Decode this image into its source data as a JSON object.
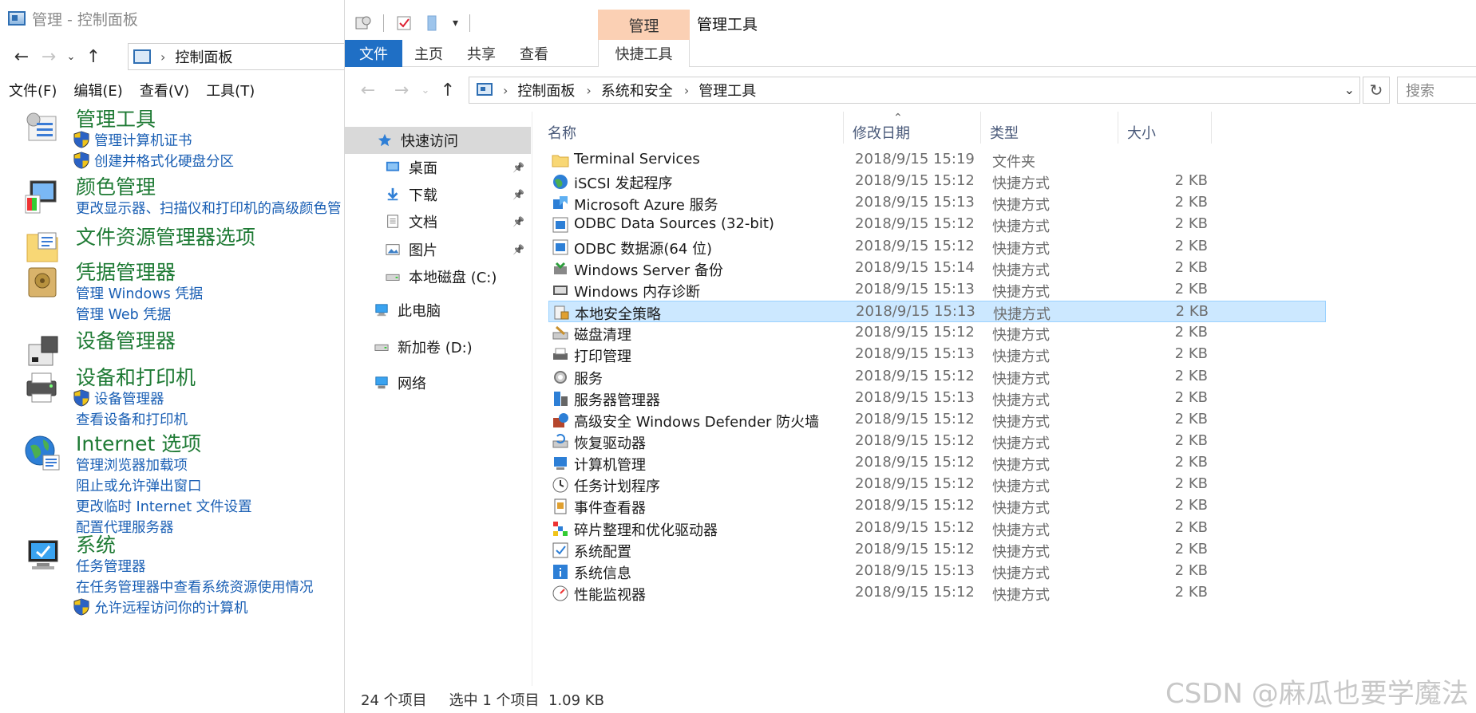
{
  "control_panel": {
    "title": "管理 - 控制面板",
    "address": "控制面板",
    "menu": [
      "文件(F)",
      "编辑(E)",
      "查看(V)",
      "工具(T)"
    ],
    "categories": [
      {
        "title": "管理工具",
        "icon": "admin-tools-icon",
        "links": [
          {
            "text": "管理计算机证书",
            "shield": true
          },
          {
            "text": "创建并格式化硬盘分区",
            "shield": true
          }
        ]
      },
      {
        "title": "颜色管理",
        "icon": "color-management-icon",
        "links": [
          {
            "text": "更改显示器、扫描仪和打印机的高级颜色管",
            "shield": false
          }
        ]
      },
      {
        "title": "文件资源管理器选项",
        "icon": "folder-options-icon",
        "links": []
      },
      {
        "title": "凭据管理器",
        "icon": "credential-manager-icon",
        "links": [
          {
            "text": "管理 Windows 凭据",
            "shield": false
          },
          {
            "text": "管理 Web 凭据",
            "shield": false
          }
        ]
      },
      {
        "title": "设备管理器",
        "icon": "device-manager-icon",
        "links": []
      },
      {
        "title": "设备和打印机",
        "icon": "devices-printers-icon",
        "links": [
          {
            "text": "设备管理器",
            "shield": true
          },
          {
            "text": "查看设备和打印机",
            "shield": false
          }
        ]
      },
      {
        "title": "Internet 选项",
        "icon": "internet-options-icon",
        "links": [
          {
            "text": "管理浏览器加载项",
            "shield": false
          },
          {
            "text": "阻止或允许弹出窗口",
            "shield": false
          },
          {
            "text": "更改临时 Internet 文件设置",
            "shield": false
          },
          {
            "text": "配置代理服务器",
            "shield": false
          }
        ]
      },
      {
        "title": "系统",
        "icon": "system-icon",
        "links": [
          {
            "text": "任务管理器",
            "shield": false
          },
          {
            "text": "在任务管理器中查看系统资源使用情况",
            "shield": false
          },
          {
            "text": "允许远程访问你的计算机",
            "shield": true
          }
        ]
      }
    ]
  },
  "explorer": {
    "title": "管理工具",
    "context_tab_group": "管理",
    "ribbon_tabs": [
      "文件",
      "主页",
      "共享",
      "查看",
      "快捷工具"
    ],
    "breadcrumb": [
      "控制面板",
      "系统和安全",
      "管理工具"
    ],
    "search_placeholder": "搜索",
    "nav_items": [
      {
        "label": "快速访问",
        "icon": "star-icon",
        "pinned": false,
        "selected": true
      },
      {
        "label": "桌面",
        "icon": "desktop-icon",
        "pinned": true
      },
      {
        "label": "下载",
        "icon": "download-icon",
        "pinned": true
      },
      {
        "label": "文档",
        "icon": "documents-icon",
        "pinned": true
      },
      {
        "label": "图片",
        "icon": "pictures-icon",
        "pinned": true
      },
      {
        "label": "本地磁盘 (C:)",
        "icon": "drive-icon",
        "pinned": false
      },
      {
        "label": "此电脑",
        "icon": "this-pc-icon",
        "pinned": false
      },
      {
        "label": "新加卷 (D:)",
        "icon": "drive-icon",
        "pinned": false
      },
      {
        "label": "网络",
        "icon": "network-icon",
        "pinned": false
      }
    ],
    "columns": [
      "名称",
      "修改日期",
      "类型",
      "大小"
    ],
    "files": [
      {
        "name": "Terminal Services",
        "date": "2018/9/15 15:19",
        "type": "文件夹",
        "size": "",
        "icon": "folder-icon"
      },
      {
        "name": "iSCSI 发起程序",
        "date": "2018/9/15 15:12",
        "type": "快捷方式",
        "size": "2 KB",
        "icon": "iscsi-icon"
      },
      {
        "name": "Microsoft Azure 服务",
        "date": "2018/9/15 15:13",
        "type": "快捷方式",
        "size": "2 KB",
        "icon": "azure-icon"
      },
      {
        "name": "ODBC Data Sources (32-bit)",
        "date": "2018/9/15 15:12",
        "type": "快捷方式",
        "size": "2 KB",
        "icon": "odbc-icon"
      },
      {
        "name": "ODBC 数据源(64 位)",
        "date": "2018/9/15 15:12",
        "type": "快捷方式",
        "size": "2 KB",
        "icon": "odbc-icon"
      },
      {
        "name": "Windows Server 备份",
        "date": "2018/9/15 15:14",
        "type": "快捷方式",
        "size": "2 KB",
        "icon": "backup-icon"
      },
      {
        "name": "Windows 内存诊断",
        "date": "2018/9/15 15:13",
        "type": "快捷方式",
        "size": "2 KB",
        "icon": "memory-diagnostic-icon"
      },
      {
        "name": "本地安全策略",
        "date": "2018/9/15 15:13",
        "type": "快捷方式",
        "size": "2 KB",
        "icon": "security-policy-icon",
        "selected": true
      },
      {
        "name": "磁盘清理",
        "date": "2018/9/15 15:12",
        "type": "快捷方式",
        "size": "2 KB",
        "icon": "disk-cleanup-icon"
      },
      {
        "name": "打印管理",
        "date": "2018/9/15 15:13",
        "type": "快捷方式",
        "size": "2 KB",
        "icon": "print-management-icon"
      },
      {
        "name": "服务",
        "date": "2018/9/15 15:12",
        "type": "快捷方式",
        "size": "2 KB",
        "icon": "services-icon"
      },
      {
        "name": "服务器管理器",
        "date": "2018/9/15 15:13",
        "type": "快捷方式",
        "size": "2 KB",
        "icon": "server-manager-icon"
      },
      {
        "name": "高级安全 Windows Defender 防火墙",
        "date": "2018/9/15 15:12",
        "type": "快捷方式",
        "size": "2 KB",
        "icon": "firewall-icon"
      },
      {
        "name": "恢复驱动器",
        "date": "2018/9/15 15:12",
        "type": "快捷方式",
        "size": "2 KB",
        "icon": "recovery-drive-icon"
      },
      {
        "name": "计算机管理",
        "date": "2018/9/15 15:12",
        "type": "快捷方式",
        "size": "2 KB",
        "icon": "computer-management-icon"
      },
      {
        "name": "任务计划程序",
        "date": "2018/9/15 15:12",
        "type": "快捷方式",
        "size": "2 KB",
        "icon": "task-scheduler-icon"
      },
      {
        "name": "事件查看器",
        "date": "2018/9/15 15:12",
        "type": "快捷方式",
        "size": "2 KB",
        "icon": "event-viewer-icon"
      },
      {
        "name": "碎片整理和优化驱动器",
        "date": "2018/9/15 15:12",
        "type": "快捷方式",
        "size": "2 KB",
        "icon": "defrag-icon"
      },
      {
        "name": "系统配置",
        "date": "2018/9/15 15:12",
        "type": "快捷方式",
        "size": "2 KB",
        "icon": "system-config-icon"
      },
      {
        "name": "系统信息",
        "date": "2018/9/15 15:13",
        "type": "快捷方式",
        "size": "2 KB",
        "icon": "system-info-icon"
      },
      {
        "name": "性能监视器",
        "date": "2018/9/15 15:12",
        "type": "快捷方式",
        "size": "2 KB",
        "icon": "performance-monitor-icon"
      }
    ],
    "status": {
      "count": "24 个项目",
      "selection": "选中 1 个项目  1.09 KB"
    }
  },
  "watermark": "CSDN @麻瓜也要学魔法",
  "colors": {
    "accent": "#1f6fc5",
    "category_green": "#1e7a34",
    "link_blue": "#1a5fb4",
    "selection": "#cce8ff",
    "context_tab": "#fbd0b4"
  }
}
